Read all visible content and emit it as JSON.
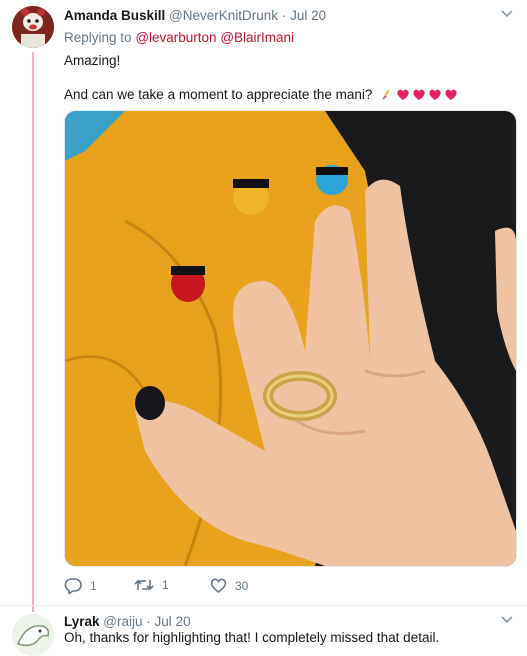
{
  "tweet1": {
    "author_name": "Amanda Buskill",
    "handle": "@NeverKnitDrunk",
    "separator": "·",
    "date": "Jul 20",
    "replying_prefix": "Replying to",
    "mentions": [
      "@levarburton",
      "@BlairImani"
    ],
    "line1": "Amazing!",
    "line2": "And can we take a moment to appreciate the mani?",
    "emoji_icons": [
      "nail-polish-icon",
      "heart-icon",
      "heart-icon",
      "heart-icon",
      "heart-icon"
    ],
    "actions": {
      "reply_count": "1",
      "retweet_count": "1",
      "like_count": "30"
    }
  },
  "tweet2": {
    "author_name": "Lyrak",
    "handle": "@raiju",
    "separator": "·",
    "date": "Jul 20",
    "text": "Oh, thanks for highlighting that! I completely missed that detail."
  },
  "colors": {
    "mention": "#c9102f",
    "thread_line": "#f3b2bb",
    "heart": "#e0245e",
    "muted": "#657786"
  }
}
